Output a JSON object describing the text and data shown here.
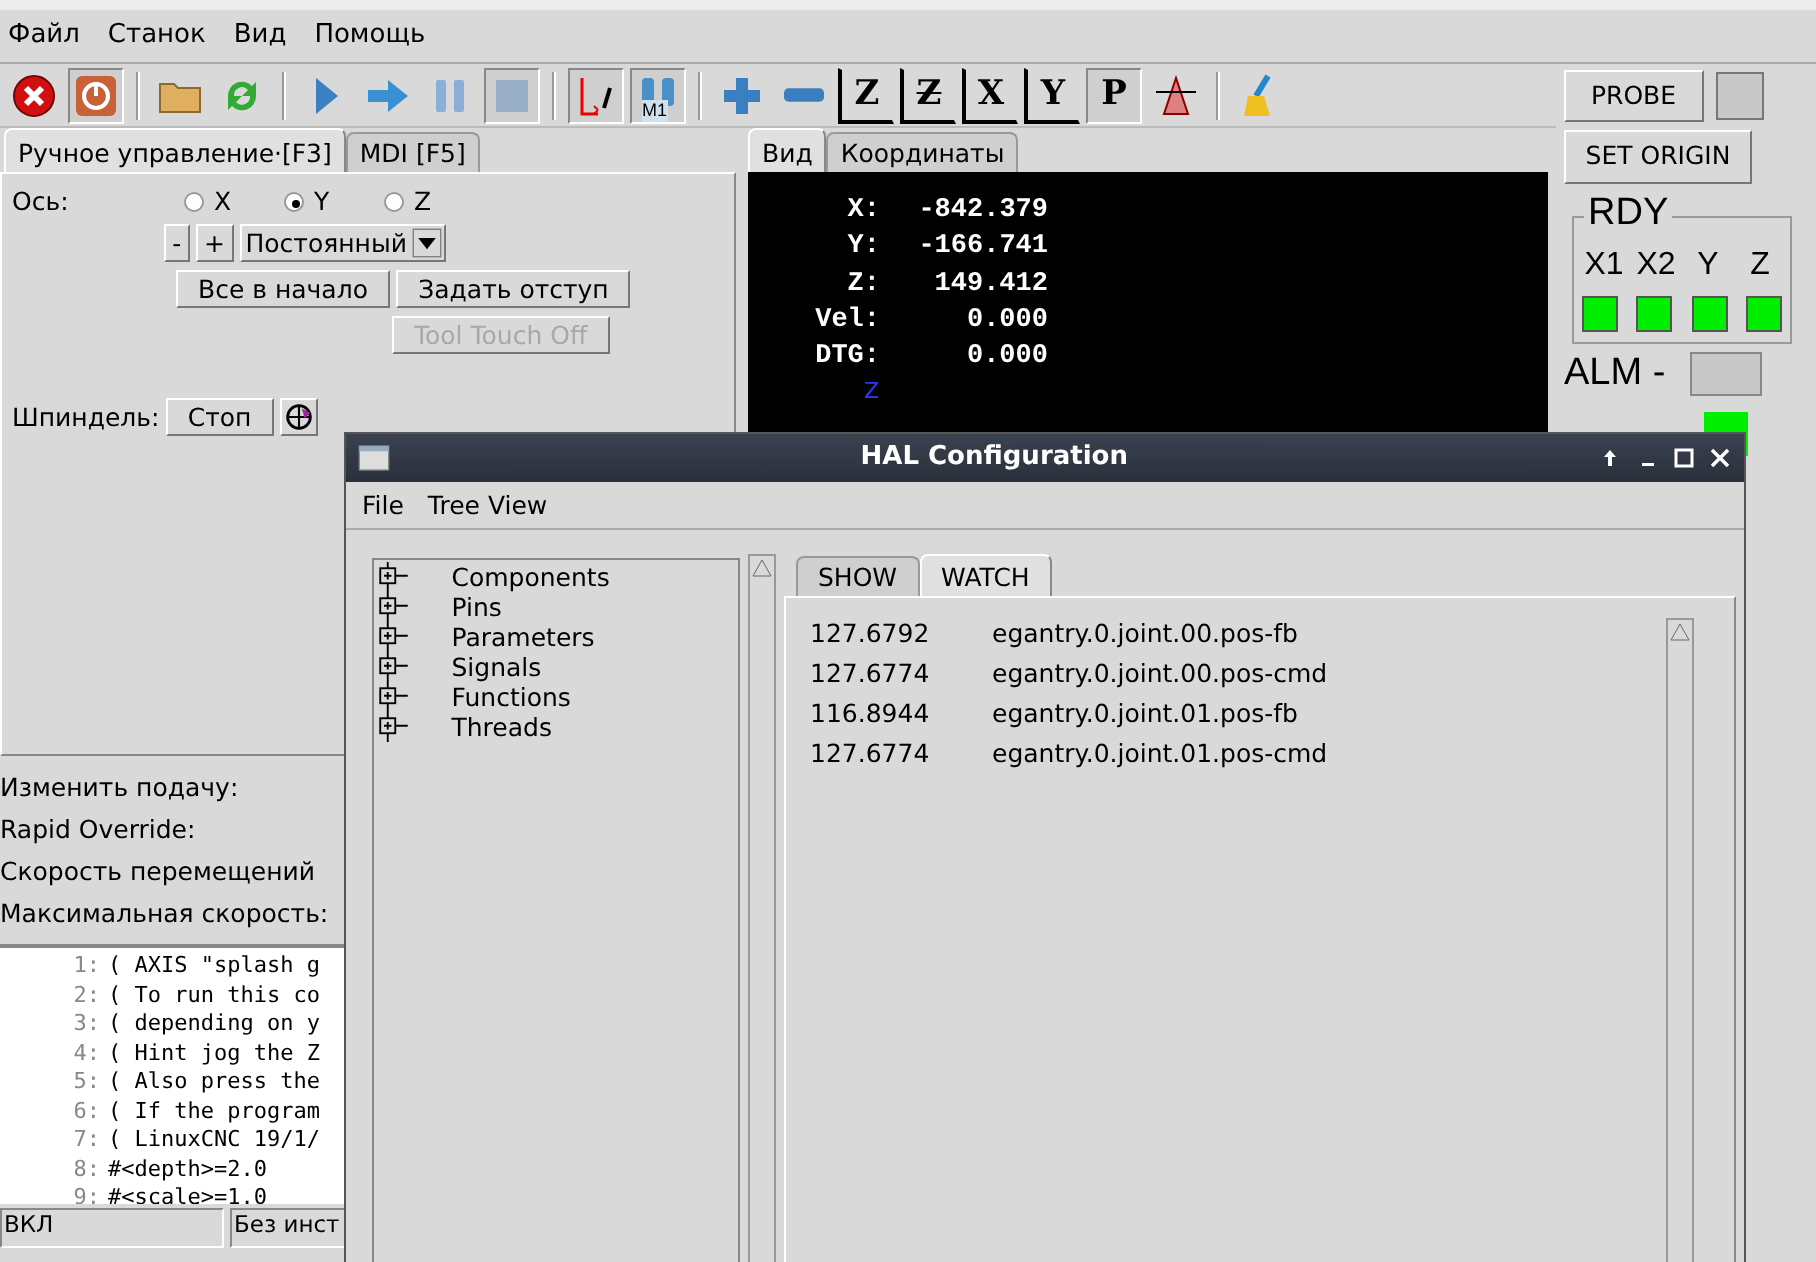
{
  "menu": [
    "Файл",
    "Станок",
    "Вид",
    "Помощь"
  ],
  "toolbar": [
    {
      "kind": "estop",
      "pressed": false
    },
    {
      "kind": "power",
      "pressed": true
    },
    {
      "kind": "separator"
    },
    {
      "kind": "open",
      "pressed": false
    },
    {
      "kind": "reload",
      "pressed": false
    },
    {
      "kind": "separator"
    },
    {
      "kind": "run",
      "pressed": false
    },
    {
      "kind": "step",
      "pressed": false
    },
    {
      "kind": "pause",
      "pressed": false
    },
    {
      "kind": "stop",
      "pressed": true
    },
    {
      "kind": "separator"
    },
    {
      "kind": "skip",
      "pressed": true
    },
    {
      "kind": "optstop",
      "pressed": true,
      "label": "M1"
    },
    {
      "kind": "separator"
    },
    {
      "kind": "zoomin",
      "pressed": false
    },
    {
      "kind": "zoomout",
      "pressed": false
    },
    {
      "kind": "view",
      "pressed": false,
      "label": "Z"
    },
    {
      "kind": "view",
      "pressed": false,
      "label": "Z",
      "rotated": true
    },
    {
      "kind": "view",
      "pressed": false,
      "label": "X"
    },
    {
      "kind": "view",
      "pressed": false,
      "label": "Y"
    },
    {
      "kind": "view",
      "pressed": true,
      "label": "P"
    },
    {
      "kind": "rotate",
      "pressed": false
    },
    {
      "kind": "separator"
    },
    {
      "kind": "clear",
      "pressed": false
    }
  ],
  "manual": {
    "tabs": [
      {
        "label": "Ручное управление·[F3]",
        "selected": true
      },
      {
        "label": "MDI [F5]",
        "selected": false
      }
    ],
    "axis_label": "Ось:",
    "axes": [
      {
        "label": "X",
        "selected": false
      },
      {
        "label": "Y",
        "selected": true
      },
      {
        "label": "Z",
        "selected": false
      }
    ],
    "jog_minus": "-",
    "jog_plus": "+",
    "jog_mode": "Постоянный",
    "home_all": "Все в начало",
    "touch_off": "Задать отступ",
    "tool_touch_off": {
      "label": "Tool Touch Off",
      "disabled": true
    },
    "spindle_label": "Шпиндель:",
    "spindle_stop": "Стоп"
  },
  "overrides": [
    "Изменить подачу:",
    "Rapid Override:",
    "Скорость перемещений",
    "Максимальная скорость:"
  ],
  "gcode": [
    {
      "number": "1:",
      "text": "( AXIS \"splash g"
    },
    {
      "number": "2:",
      "text": "( To run this co"
    },
    {
      "number": "3:",
      "text": "( depending on y"
    },
    {
      "number": "4:",
      "text": "( Hint jog the Z"
    },
    {
      "number": "5:",
      "text": "( Also press the"
    },
    {
      "number": "6:",
      "text": "( If the program"
    },
    {
      "number": "7:",
      "text": "( LinuxCNC 19/1/"
    },
    {
      "number": "8:",
      "text": "#<depth>=2.0"
    },
    {
      "number": "9:",
      "text": "#<scale>=1.0"
    }
  ],
  "status_bar": [
    "ВКЛ",
    "Без инст"
  ],
  "view_tabs": [
    {
      "label": "Вид",
      "selected": true
    },
    {
      "label": "Координаты",
      "selected": false
    }
  ],
  "dro": [
    {
      "label": "X:",
      "value": "-842.379"
    },
    {
      "label": "Y:",
      "value": "-166.741"
    },
    {
      "label": "Z:",
      "value": "149.412"
    },
    {
      "label": "Vel:",
      "value": "0.000"
    },
    {
      "label": "DTG:",
      "value": "0.000"
    }
  ],
  "axis_marker": "Z",
  "side": {
    "probe": "PROBE",
    "probe_on": false,
    "set_origin": "SET ORIGIN",
    "rdy_title": "RDY",
    "rdy": [
      {
        "label": "X1",
        "on": true
      },
      {
        "label": "X2",
        "on": true
      },
      {
        "label": "Y",
        "on": true
      },
      {
        "label": "Z",
        "on": true
      }
    ],
    "alm_label": "ALM -",
    "alm_on": false,
    "extra_on": true
  },
  "hal": {
    "title": "HAL Configuration",
    "menu": [
      "File",
      "Tree View"
    ],
    "tree": [
      "Components",
      "Pins",
      "Parameters",
      "Signals",
      "Functions",
      "Threads"
    ],
    "tabs": [
      {
        "label": "SHOW",
        "selected": false
      },
      {
        "label": "WATCH",
        "selected": true
      }
    ],
    "watch": [
      {
        "value": "127.6792",
        "pin": "egantry.0.joint.00.pos-fb"
      },
      {
        "value": "127.6774",
        "pin": "egantry.0.joint.00.pos-cmd"
      },
      {
        "value": "116.8944",
        "pin": "egantry.0.joint.01.pos-fb"
      },
      {
        "value": "127.6774",
        "pin": "egantry.0.joint.01.pos-cmd"
      }
    ]
  }
}
